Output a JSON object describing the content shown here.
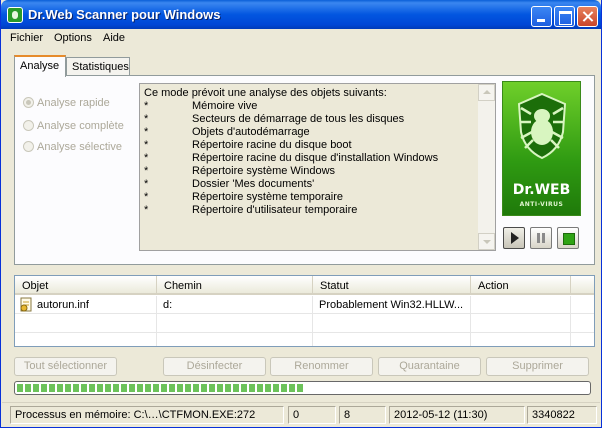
{
  "window": {
    "title": "Dr.Web Scanner pour Windows",
    "controls": [
      "minimize",
      "maximize",
      "close"
    ]
  },
  "menu": [
    "Fichier",
    "Options",
    "Aide"
  ],
  "tabs": [
    {
      "label": "Analyse",
      "active": true
    },
    {
      "label": "Statistiques",
      "active": false
    }
  ],
  "scan_modes": [
    {
      "label": "Analyse rapide",
      "selected": true,
      "enabled": false
    },
    {
      "label": "Analyse complète",
      "selected": false,
      "enabled": false
    },
    {
      "label": "Analyse sélective",
      "selected": false,
      "enabled": false
    }
  ],
  "info": {
    "heading": "Ce mode prévoit une analyse des objets suivants:",
    "bullet": "*",
    "items": [
      "Mémoire vive",
      "Secteurs de démarrage de tous les disques",
      "Objets d'autodémarrage",
      "Répertoire racine du disque boot",
      "Répertoire racine du disque d'installation Windows",
      "Répertoire système Windows",
      "Dossier 'Mes documents'",
      "Répertoire système temporaire",
      "Répertoire d'utilisateur temporaire"
    ]
  },
  "logo": {
    "brand": "Dr.WEB",
    "subtitle": "ANTI-VIRUS",
    "color": "#3aa814"
  },
  "scan_controls": [
    "play-icon",
    "pause-icon",
    "stop-icon"
  ],
  "results": {
    "columns": [
      "Objet",
      "Chemin",
      "Statut",
      "Action"
    ],
    "rows": [
      {
        "object": "autorun.inf",
        "path": "d:",
        "status": "Probablement Win32.HLLW...",
        "action": ""
      }
    ]
  },
  "actions": [
    "Tout sélectionner",
    "Désinfecter",
    "Renommer",
    "Quarantaine",
    "Supprimer"
  ],
  "progress": {
    "fraction": 0.5,
    "color": "#6cc25a"
  },
  "statusbar": {
    "process": "Processus en mémoire: C:\\…\\CTFMON.EXE:272",
    "count_a": "0",
    "count_b": "8",
    "datetime": "2012-05-12 (11:30)",
    "number": "3340822"
  }
}
